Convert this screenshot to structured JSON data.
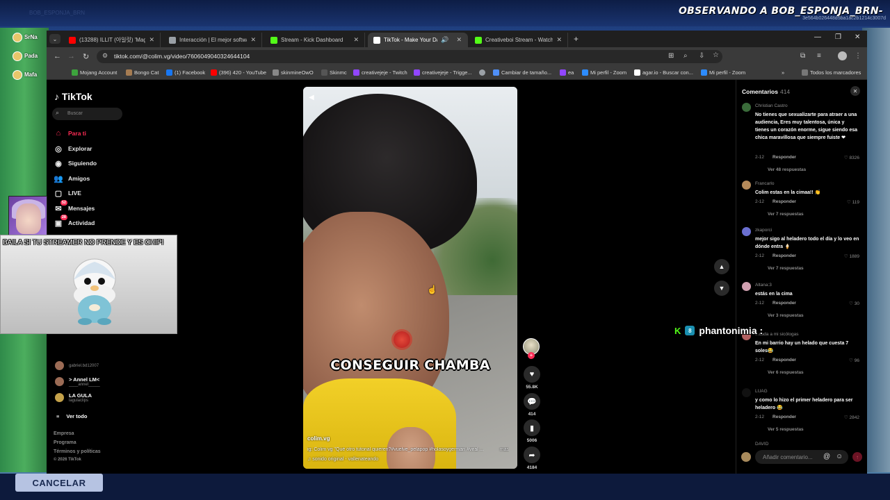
{
  "stream": {
    "title": "OBSERVANDO A BOB_ESPONJA_BRN-",
    "id_text": "3e564b026448d5ba1ac2b1214c3007d",
    "ghost_text": "BOB_ESPONJA_BRN",
    "chat": [
      {
        "name": "SrNa"
      },
      {
        "name": "Pada"
      },
      {
        "name": "Mafa"
      }
    ],
    "cancel_label": "CANCELAR",
    "dance_text": "BAILA SI TU STREAMER NO PRENDE Y ES CHIPI",
    "chat_user": "phantonimia :",
    "chat_badge": "8"
  },
  "browser": {
    "tabs": [
      {
        "label": "(13288) ILLIT (아일릿) 'Magnetic'",
        "color": "#ff0000"
      },
      {
        "label": "Interacción | El mejor software",
        "color": "#9aa0a6"
      },
      {
        "label": "Stream - Kick Dashboard",
        "color": "#53fc18"
      },
      {
        "label": "TikTok - Make Your Day",
        "color": "#ffffff"
      },
      {
        "label": "Creativeboi Stream - Watch Live",
        "color": "#53fc18"
      }
    ],
    "url": "tiktok.com/@colim.vg/video/7606049040324644104",
    "bookmarks": [
      {
        "label": "Mojang Account",
        "color": "#3da33d"
      },
      {
        "label": "Bongo Cat",
        "color": "#a57c52"
      },
      {
        "label": "(1) Facebook",
        "color": "#1877f2"
      },
      {
        "label": "(396) 420 - YouTube",
        "color": "#ff0000"
      },
      {
        "label": "skinmineOwO",
        "color": "#888888"
      },
      {
        "label": "Skinmc",
        "color": "#555555"
      },
      {
        "label": "creativejeje - Twitch",
        "color": "#9146ff"
      },
      {
        "label": "creativejeje - Trigge...",
        "color": "#9146ff"
      },
      {
        "label": "",
        "color": "#9aa0a6"
      },
      {
        "label": "Cambiar de tamaño...",
        "color": "#4f8ff7"
      },
      {
        "label": "ea",
        "color": "#9146ff"
      },
      {
        "label": "Mi perfil - Zoom",
        "color": "#2d8cff"
      },
      {
        "label": "agar.io - Buscar con...",
        "color": "#ffffff"
      },
      {
        "label": "Mi perfil - Zoom",
        "color": "#2d8cff"
      }
    ],
    "all_bookmarks": "Todos los marcadores"
  },
  "tiktok": {
    "logo": "TikTok",
    "search_placeholder": "Buscar",
    "nav": [
      {
        "label": "Para ti",
        "icon": "home-icon",
        "badge": ""
      },
      {
        "label": "Explorar",
        "icon": "compass-icon",
        "badge": ""
      },
      {
        "label": "Siguiendo",
        "icon": "following-icon",
        "badge": ""
      },
      {
        "label": "Amigos",
        "icon": "friends-icon",
        "badge": ""
      },
      {
        "label": "LIVE",
        "icon": "live-icon",
        "badge": ""
      },
      {
        "label": "Mensajes",
        "icon": "message-icon",
        "badge": "52"
      },
      {
        "label": "Actividad",
        "icon": "activity-icon",
        "badge": "28"
      }
    ],
    "following": [
      {
        "name": "",
        "sub": "gabriel.bd12007"
      },
      {
        "name": "> Annel LM<",
        "sub": "____annel_____"
      },
      {
        "name": "LA GULA",
        "sub": "lagulaclips"
      }
    ],
    "see_all": "Ver todo",
    "footer": [
      "Empresa",
      "Programa",
      "Términos y políticas",
      "© 2026 TikTok"
    ],
    "video": {
      "caption": "CONSEGUIR CHAMBA",
      "user": "colim.vg",
      "description": "ig: Colim vg \"Qué otro tutorial quieren?#vuelve_pelapop #holasoygerman #viral ...",
      "more": "más",
      "sound": "sonido original - vallenateando"
    },
    "actions": {
      "likes": "55.8K",
      "comments": "414",
      "saves": "5006",
      "shares": "4184"
    },
    "comments_title": "Comentarios",
    "comments_count": "414",
    "comments": [
      {
        "user": "Christian Castro",
        "text": "No tienes que sexualizarte para atraer a una audiencia, Eres muy talentosa, única y tienes un corazón enorme, sigue siendo esa chica maravillosa que siempre fuiste ❤",
        "date": "2-12",
        "reply": "Responder",
        "likes": "8326",
        "replies": "Ver 48 respuestas",
        "color": "#3a6b3a"
      },
      {
        "user": "Francarlo",
        "text": "Colim estas en la cimaa!! 👏",
        "date": "2-12",
        "reply": "Responder",
        "likes": "119",
        "replies": "Ver 7 respuestas",
        "color": "#b58a5a"
      },
      {
        "user": "zkaporci",
        "text": "mejor sigo al heladero todo el día y lo veo en dónde entra 🍦",
        "date": "2-12",
        "reply": "Responder",
        "likes": "1889",
        "replies": "Ver 7 respuestas",
        "color": "#6a6fd0"
      },
      {
        "user": "Altana:3",
        "text": "estás en la cima",
        "date": "2-12",
        "reply": "Responder",
        "likes": "30",
        "replies": "Ver 3 respuestas",
        "color": "#d0a0b0"
      },
      {
        "user": "...cada a mi sicólogas",
        "text": "En mi barrio hay un helado que cuesta 7 soles😂",
        "date": "2-12",
        "reply": "Responder",
        "likes": "96",
        "replies": "Ver 6 respuestas",
        "color": "#b06060"
      },
      {
        "user": "LUAG",
        "text": "y como lo hizo el primer heladero para ser heladero 😂",
        "date": "2-12",
        "reply": "Responder",
        "likes": "2842",
        "replies": "Ver 5 respuestas",
        "color": "#111111"
      },
      {
        "user": "DAVID",
        "text": "",
        "date": "",
        "reply": "",
        "likes": "",
        "replies": "",
        "color": "#333333"
      }
    ],
    "add_comment_placeholder": "Añadir comentario..."
  }
}
